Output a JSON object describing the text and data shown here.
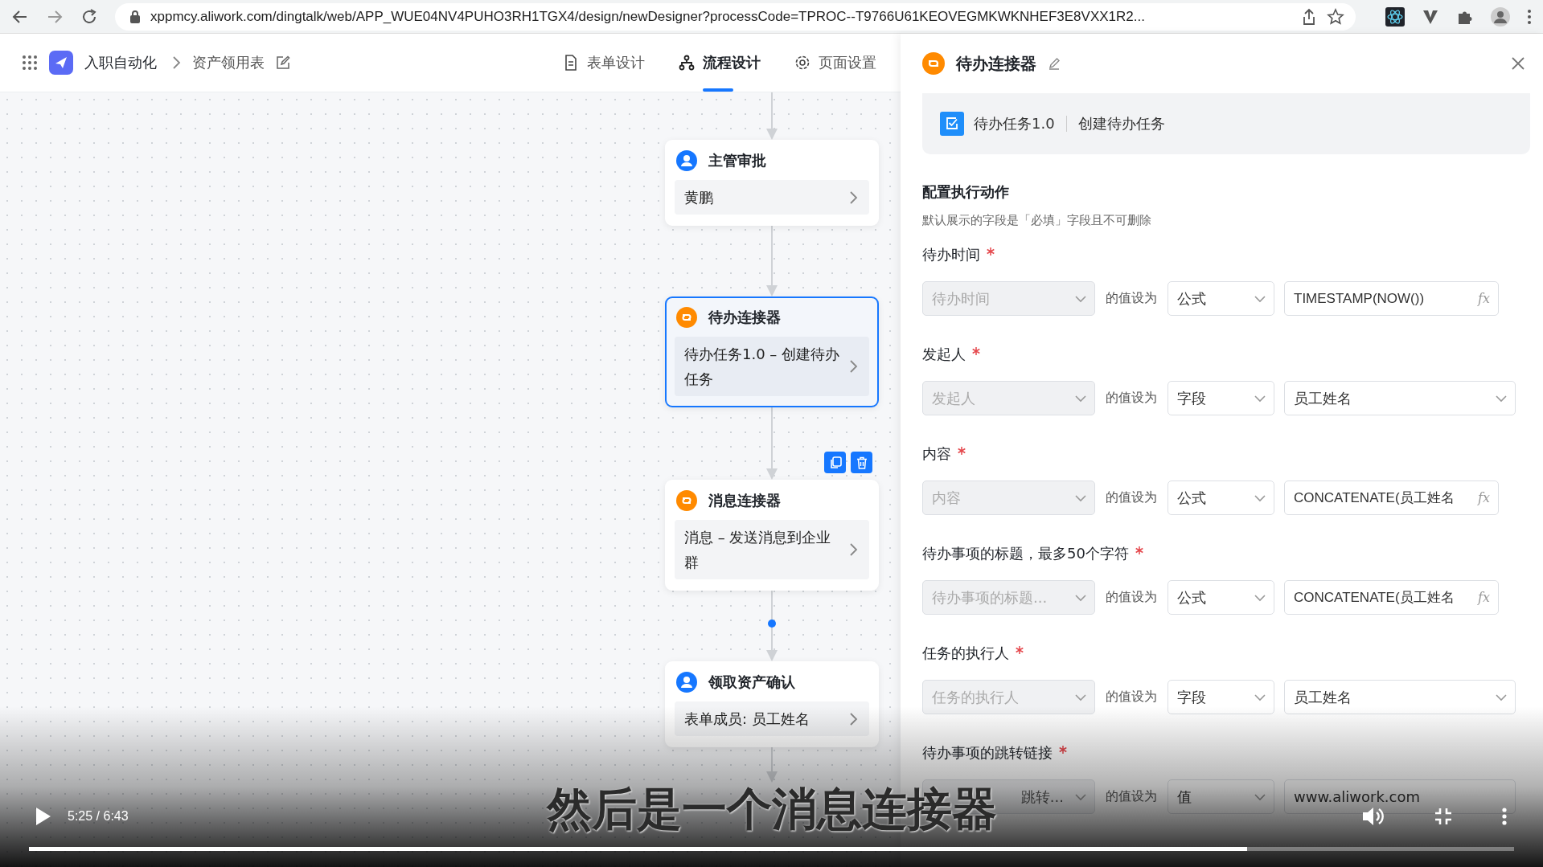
{
  "browser": {
    "url": "xppmcy.aliwork.com/dingtalk/web/APP_WUE04NV4PUHO3RH1TGX4/design/newDesigner?processCode=TPROC--T9766U61KEOVEGMKWKNHEF3E8VXX1R2..."
  },
  "app_header": {
    "app_name": "入职自动化",
    "form_name": "资产领用表",
    "tabs": [
      {
        "label": "表单设计",
        "kind": "form",
        "selected": false
      },
      {
        "label": "流程设计",
        "kind": "flow",
        "selected": true
      },
      {
        "label": "页面设置",
        "kind": "settings",
        "selected": false
      }
    ]
  },
  "canvas": {
    "nodes": [
      {
        "kind": "approval",
        "title": "主管审批",
        "detail": "黄鹏",
        "selected": false,
        "hovered": false
      },
      {
        "kind": "connector",
        "title": "待办连接器",
        "detail": "待办任务1.0 – 创建待办任务",
        "selected": true,
        "hovered": false
      },
      {
        "kind": "connector",
        "title": "消息连接器",
        "detail": "消息 – 发送消息到企业群",
        "selected": false,
        "hovered": true
      },
      {
        "kind": "approval",
        "title": "领取资产确认",
        "detail": "表单成员: 员工姓名",
        "selected": false,
        "hovered": false
      }
    ]
  },
  "panel": {
    "title": "待办连接器",
    "action": {
      "app": "待办任务1.0",
      "name": "创建待办任务"
    },
    "section_title": "配置执行动作",
    "hint": "默认展示的字段是「必填」字段且不可删除",
    "fields": [
      {
        "kind": "formula",
        "label": "待办时间",
        "required": true,
        "target": "待办时间",
        "relation": "的值设为",
        "mode": "公式",
        "value": "TIMESTAMP(NOW())",
        "suffix": "fx"
      },
      {
        "kind": "field",
        "label": "发起人",
        "required": true,
        "target": "发起人",
        "relation": "的值设为",
        "mode": "字段",
        "value": "员工姓名"
      },
      {
        "kind": "formula",
        "label": "内容",
        "required": true,
        "target": "内容",
        "relation": "的值设为",
        "mode": "公式",
        "value": "CONCATENATE(员工姓名",
        "suffix": "fx"
      },
      {
        "kind": "formula",
        "label": "待办事项的标题，最多50个字符",
        "required": true,
        "target": "待办事项的标题...",
        "relation": "的值设为",
        "mode": "公式",
        "value": "CONCATENATE(员工姓名",
        "suffix": "fx"
      },
      {
        "kind": "field",
        "label": "任务的执行人",
        "required": true,
        "target": "任务的执行人",
        "relation": "的值设为",
        "mode": "字段",
        "value": "员工姓名"
      },
      {
        "kind": "value",
        "label": "待办事项的跳转链接",
        "required": true,
        "target": "跳转...",
        "relation": "的值设为",
        "mode": "值",
        "value": "www.aliwork.com"
      }
    ]
  },
  "player": {
    "subtitle": "然后是一个消息连接器",
    "time": "5:25 / 6:43",
    "playing": false,
    "progress": {
      "level": 0.82
    }
  }
}
